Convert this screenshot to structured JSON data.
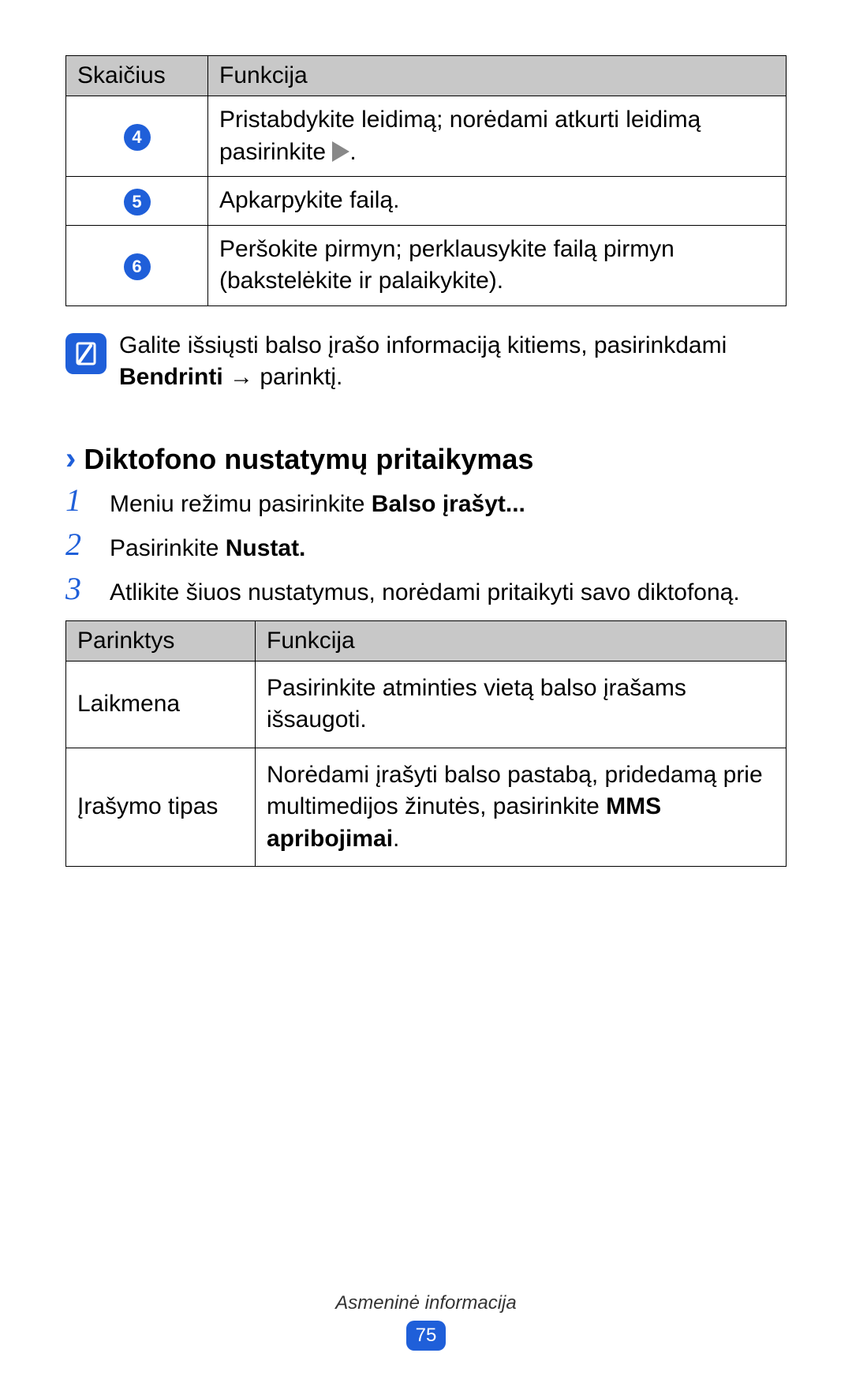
{
  "table1": {
    "head": {
      "c1": "Skaičius",
      "c2": "Funkcija"
    },
    "rows": [
      {
        "num": "4",
        "text_a": "Pristabdykite leidimą; norėdami atkurti leidimą pasirinkite ",
        "text_b": "."
      },
      {
        "num": "5",
        "text": "Apkarpykite failą."
      },
      {
        "num": "6",
        "text": "Peršokite pirmyn; perklausykite failą pirmyn (bakstelėkite ir palaikykite)."
      }
    ]
  },
  "note": {
    "pre": "Galite išsiųsti balso įrašo informaciją kitiems, pasirinkdami ",
    "bold": "Bendrinti",
    "arrow": " → ",
    "post": "parinktį."
  },
  "heading": "Diktofono nustatymų pritaikymas",
  "steps": [
    {
      "n": "1",
      "pre": "Meniu režimu pasirinkite ",
      "bold": "Balso įrašyt..."
    },
    {
      "n": "2",
      "pre": "Pasirinkite ",
      "bold": "Nustat."
    },
    {
      "n": "3",
      "pre": "Atlikite šiuos nustatymus, norėdami pritaikyti savo diktofoną."
    }
  ],
  "table2": {
    "head": {
      "c1": "Parinktys",
      "c2": "Funkcija"
    },
    "rows": [
      {
        "name": "Laikmena",
        "desc": "Pasirinkite atminties vietą balso įrašams išsaugoti."
      },
      {
        "name": "Įrašymo tipas",
        "desc_a": "Norėdami įrašyti balso pastabą, pridedamą prie multimedijos žinutės, pasirinkite ",
        "desc_bold": "MMS apribojimai",
        "desc_b": "."
      }
    ]
  },
  "footer": {
    "label": "Asmeninė informacija",
    "page": "75"
  }
}
